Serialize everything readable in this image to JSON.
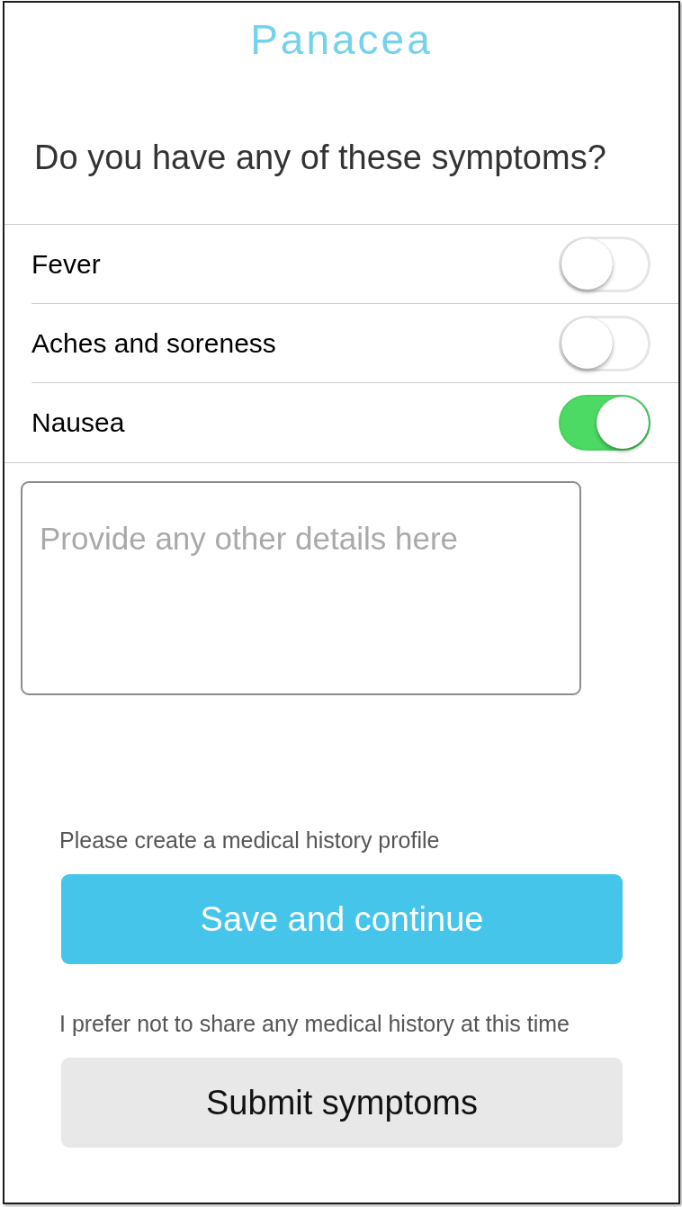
{
  "app": {
    "title": "Panacea"
  },
  "question": "Do you have any of these symptoms?",
  "symptoms": [
    {
      "label": "Fever",
      "on": false
    },
    {
      "label": "Aches and soreness",
      "on": false
    },
    {
      "label": "Nausea",
      "on": true
    }
  ],
  "details": {
    "placeholder": "Provide any other details here"
  },
  "actions": [
    {
      "prompt": "Please create a medical history profile",
      "button": "Save and continue",
      "kind": "primary"
    },
    {
      "prompt": "I prefer not to share any medical history at this time",
      "button": "Submit symptoms",
      "kind": "secondary"
    }
  ]
}
